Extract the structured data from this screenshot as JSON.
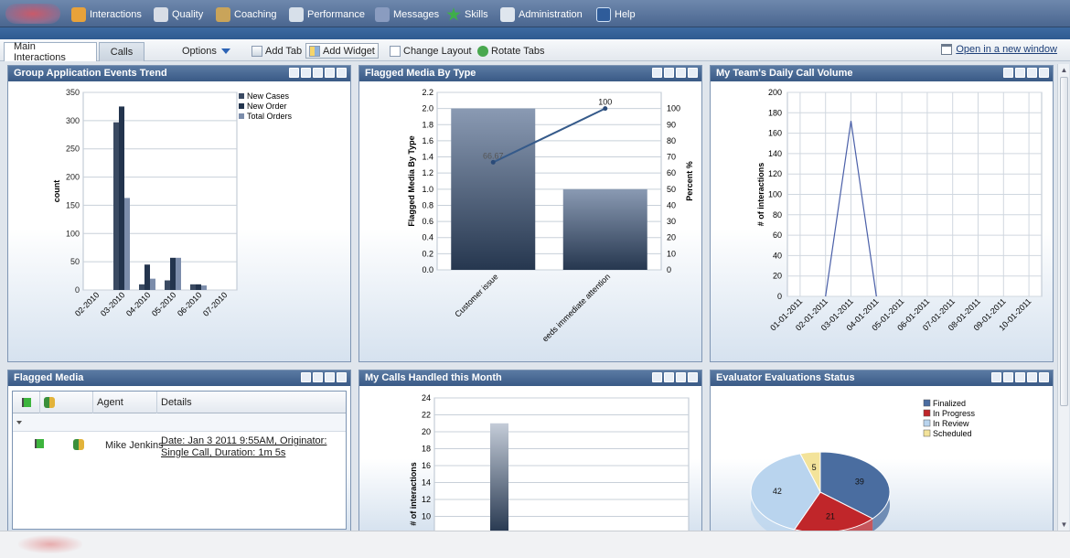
{
  "nav": {
    "items": [
      {
        "label": "Interactions",
        "icon": "interactions-icon",
        "color": "#e8a23a"
      },
      {
        "label": "Quality",
        "icon": "quality-icon",
        "color": "#d8dde6"
      },
      {
        "label": "Coaching",
        "icon": "coaching-icon",
        "color": "#c9a45a"
      },
      {
        "label": "Performance",
        "icon": "performance-icon",
        "color": "#d7e0ea"
      },
      {
        "label": "Messages",
        "icon": "messages-icon",
        "color": "#8a9cc0"
      },
      {
        "label": "Skills",
        "icon": "skills-icon",
        "color": "#3fae4a"
      },
      {
        "label": "Administration",
        "icon": "administration-icon",
        "color": "#dfe6ee"
      },
      {
        "label": "Help",
        "icon": "help-icon",
        "color": "#2f5c9a"
      }
    ]
  },
  "toolbar": {
    "tabs": [
      {
        "label": "Main Interactions"
      },
      {
        "label": "Calls"
      }
    ],
    "options": "Options",
    "add_tab": "Add Tab",
    "add_widget": "Add Widget",
    "change_layout": "Change Layout",
    "rotate_tabs": "Rotate Tabs",
    "open_new_window": "Open in a new window"
  },
  "panels": {
    "group_trend": {
      "title": "Group Application Events Trend"
    },
    "flagged_type": {
      "title": "Flagged Media By Type"
    },
    "daily_volume": {
      "title": "My Team's Daily Call Volume"
    },
    "flagged_media": {
      "title": "Flagged Media",
      "columns": [
        "Agent",
        "Details"
      ],
      "rows": [
        {
          "agent": "Mike Jenkins",
          "details_line1": "Date: Jan 3 2011 9:55AM, Originator:",
          "details_line2": "Single Call, Duration: 1m 5s"
        }
      ]
    },
    "calls_month": {
      "title": "My Calls Handled this Month"
    },
    "eval_status": {
      "title": "Evaluator Evaluations Status"
    }
  },
  "chart_data": [
    {
      "type": "bar",
      "title": "Group Application Events Trend",
      "ylabel": "count",
      "ylim": [
        0,
        350
      ],
      "yticks": [
        0,
        50,
        100,
        150,
        200,
        250,
        300,
        350
      ],
      "categories": [
        "02-2010",
        "03-2010",
        "04-2010",
        "05-2010",
        "06-2010",
        "07-2010"
      ],
      "series": [
        {
          "name": "New Cases",
          "values": [
            0,
            297,
            10,
            17,
            10,
            0
          ],
          "color": "#3a4a62"
        },
        {
          "name": "New Order",
          "values": [
            0,
            325,
            45,
            57,
            10,
            0
          ],
          "color": "#23344d"
        },
        {
          "name": "Total Orders",
          "values": [
            0,
            163,
            20,
            57,
            8,
            0
          ],
          "color": "#7c8dab"
        }
      ],
      "legend": "top-right",
      "grid": true
    },
    {
      "type": "bar",
      "title": "Flagged Media By Type",
      "ylabel": "Flagged Media By Type",
      "y2label": "Percent %",
      "ylim": [
        0,
        2.2
      ],
      "yticks": [
        0.0,
        0.2,
        0.4,
        0.6,
        0.8,
        1.0,
        1.2,
        1.4,
        1.6,
        1.8,
        2.0,
        2.2
      ],
      "y2lim": [
        0,
        110
      ],
      "y2ticks": [
        0,
        10,
        20,
        30,
        40,
        50,
        60,
        70,
        80,
        90,
        100
      ],
      "categories": [
        "Customer issue",
        "eeds immediate attention"
      ],
      "values": [
        2.0,
        1.0
      ],
      "line": {
        "values": [
          66.67,
          100
        ],
        "labels": [
          "66.67",
          "100"
        ]
      },
      "grid": true
    },
    {
      "type": "line",
      "title": "My Team's Daily Call Volume",
      "ylabel": "# of interactions",
      "ylim": [
        0,
        200
      ],
      "yticks": [
        0,
        20,
        40,
        60,
        80,
        100,
        120,
        140,
        160,
        180,
        200
      ],
      "x": [
        "01-01-2011",
        "02-01-2011",
        "03-01-2011",
        "04-01-2011",
        "05-01-2011",
        "06-01-2011",
        "07-01-2011",
        "08-01-2011",
        "09-01-2011",
        "10-01-2011"
      ],
      "values": [
        null,
        0,
        172,
        0,
        null,
        null,
        null,
        null,
        null,
        null
      ],
      "grid": true
    },
    {
      "type": "bar",
      "title": "My Calls Handled this Month",
      "ylabel": "# of interactions",
      "ylim": [
        0,
        24
      ],
      "yticks": [
        10,
        12,
        14,
        16,
        18,
        20,
        22,
        24
      ],
      "values": [
        21
      ],
      "grid": true
    },
    {
      "type": "pie",
      "title": "Evaluator Evaluations Status",
      "legend": "top-right",
      "slices": [
        {
          "name": "Finalized",
          "value": 39,
          "color": "#4a6da0"
        },
        {
          "name": "In Progress",
          "value": 21,
          "color": "#c0262a"
        },
        {
          "name": "In Review",
          "value": 42,
          "color": "#b9d4ee"
        },
        {
          "name": "Scheduled",
          "value": 5,
          "color": "#f3e39a"
        }
      ],
      "labels": [
        "39",
        "21",
        "42",
        "5"
      ]
    }
  ]
}
